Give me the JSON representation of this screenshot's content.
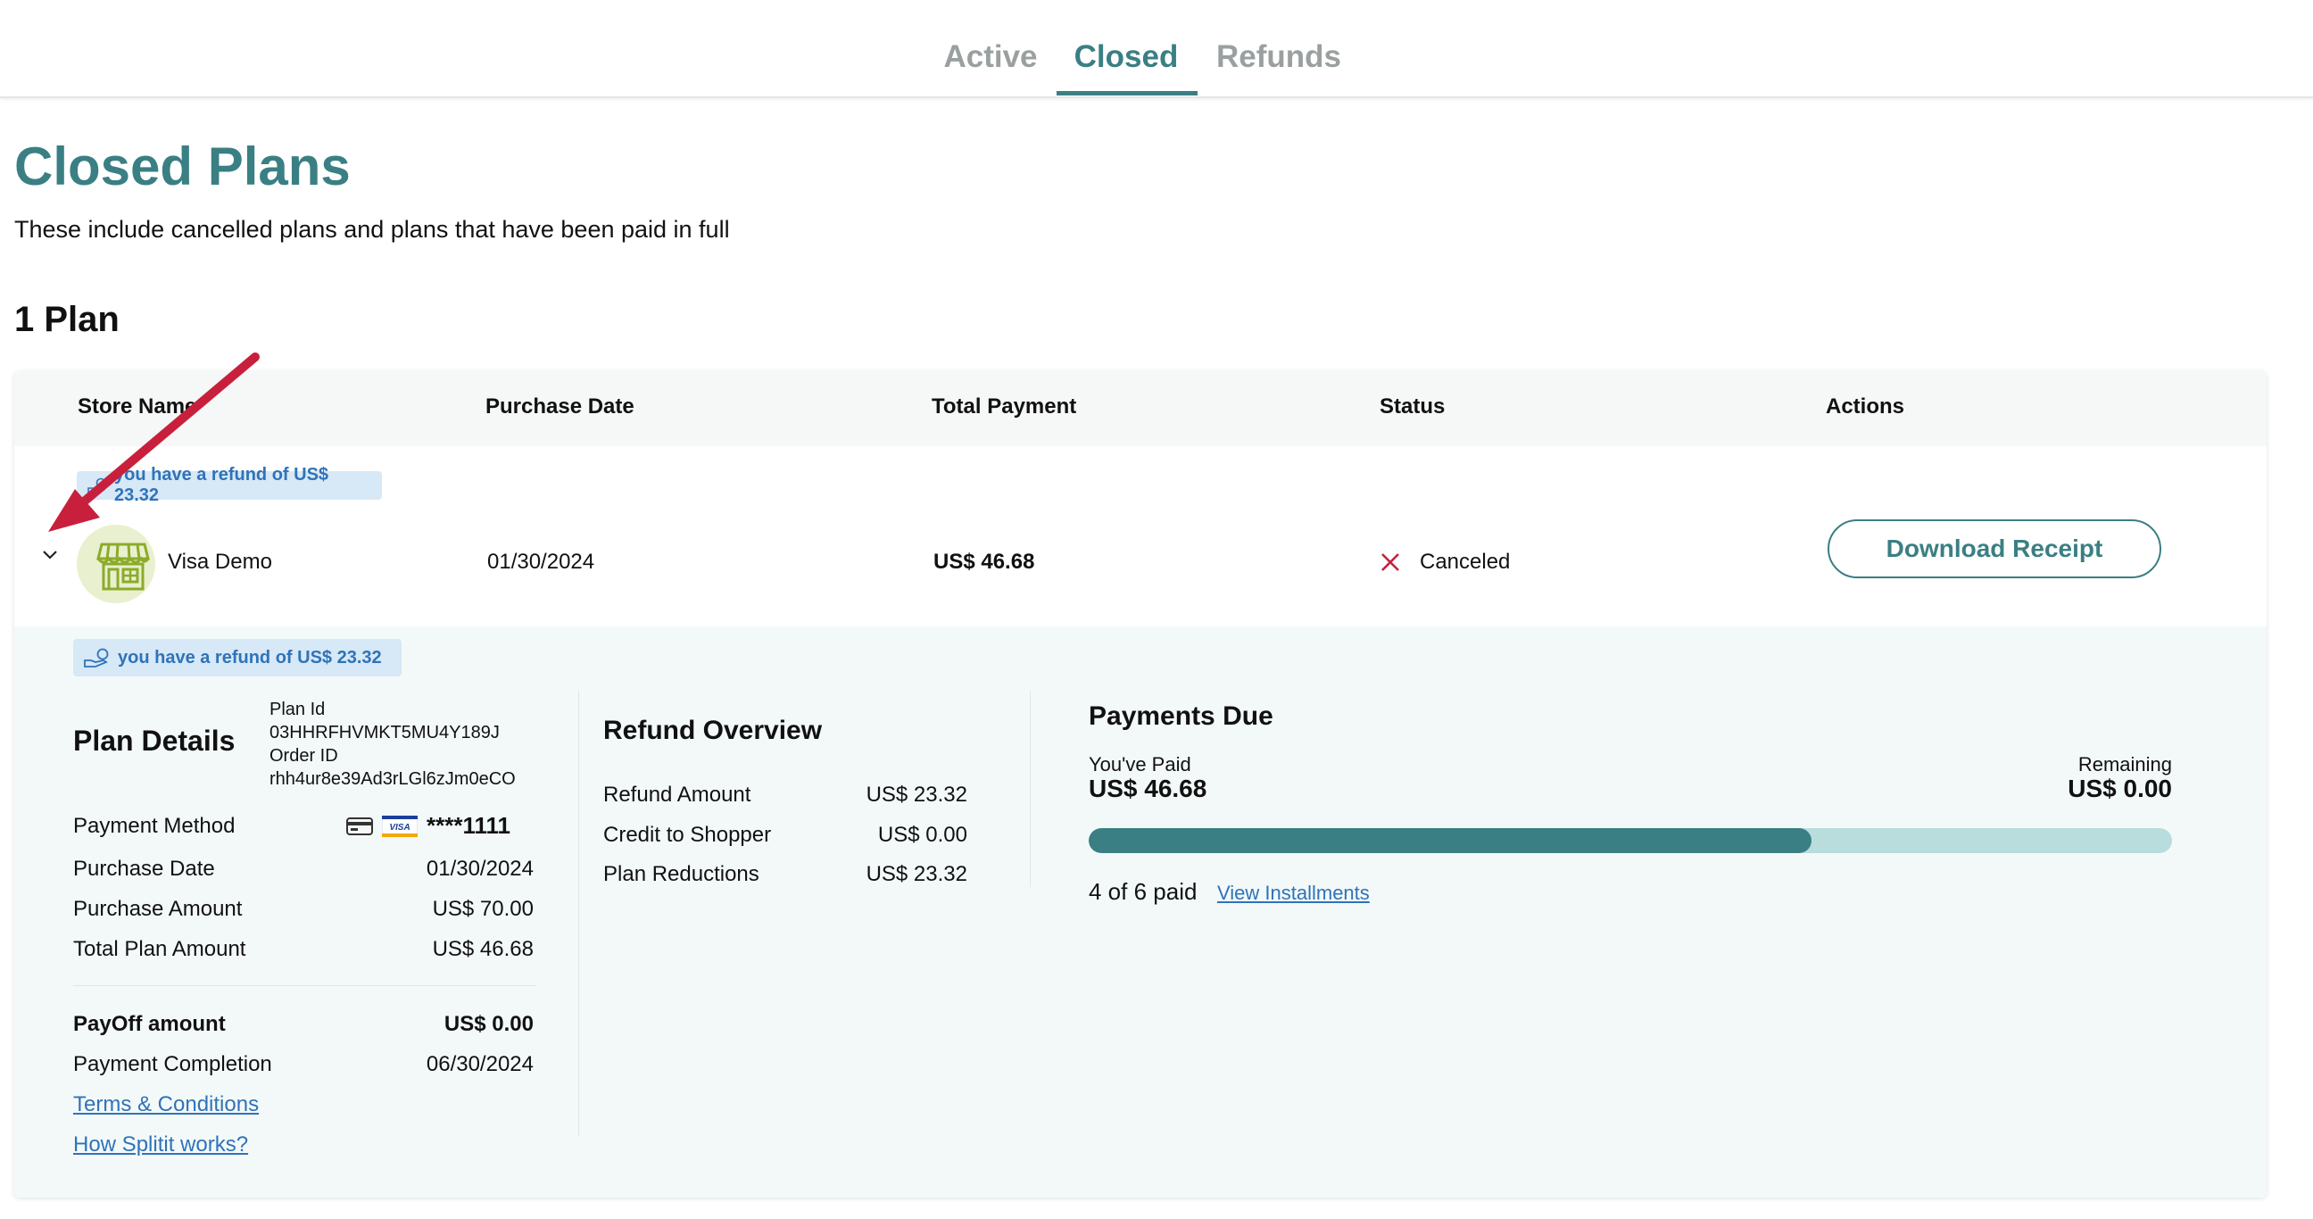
{
  "tabs": [
    {
      "label": "Active"
    },
    {
      "label": "Closed"
    },
    {
      "label": "Refunds"
    }
  ],
  "header": {
    "title": "Closed Plans",
    "subtitle": "These include cancelled plans and plans that have been paid in full",
    "count": "1 Plan"
  },
  "table": {
    "columns": [
      "Store Name",
      "Purchase Date",
      "Total Payment",
      "Status",
      "Actions"
    ]
  },
  "row": {
    "refund_badge": "you have a refund of US$ 23.32",
    "store_name": "Visa Demo",
    "purchase_date": "01/30/2024",
    "total_payment": "US$ 46.68",
    "status": "Canceled",
    "action_label": "Download Receipt"
  },
  "details": {
    "refund_badge": "you have a refund of US$ 23.32",
    "plan_details": {
      "title": "Plan Details",
      "plan_id_label": "Plan Id",
      "plan_id": "03HHRFHVMKT5MU4Y189J",
      "order_id_label": "Order ID",
      "order_id": "rhh4ur8e39Ad3rLGl6zJm0eCO",
      "payment_method_label": "Payment Method",
      "card_brand": "VISA",
      "card_number": "****1111",
      "rows": [
        {
          "label": "Purchase Date",
          "value": "01/30/2024"
        },
        {
          "label": "Purchase Amount",
          "value": "US$ 70.00"
        },
        {
          "label": "Total Plan Amount",
          "value": "US$ 46.68"
        }
      ],
      "payoff_label": "PayOff amount",
      "payoff_value": "US$ 0.00",
      "completion_label": "Payment Completion",
      "completion_value": "06/30/2024",
      "terms_link": "Terms & Conditions",
      "how_link": "How Splitit works?"
    },
    "refund_overview": {
      "title": "Refund Overview",
      "rows": [
        {
          "label": "Refund Amount",
          "value": "US$ 23.32"
        },
        {
          "label": "Credit to Shopper",
          "value": "US$ 0.00"
        },
        {
          "label": "Plan Reductions",
          "value": "US$ 23.32"
        }
      ]
    },
    "payments_due": {
      "title": "Payments Due",
      "paid_label": "You've Paid",
      "paid_value": "US$ 46.68",
      "remaining_label": "Remaining",
      "remaining_value": "US$ 0.00",
      "progress_fraction": 0.667,
      "paid_count": "4 of 6 paid",
      "view_link": "View Installments"
    }
  },
  "colors": {
    "brand": "#3a7f83",
    "progress_track": "#b9dcdc",
    "link": "#2f73b9",
    "badge_bg": "#d7e8f6",
    "annotation": "#c8203c"
  }
}
